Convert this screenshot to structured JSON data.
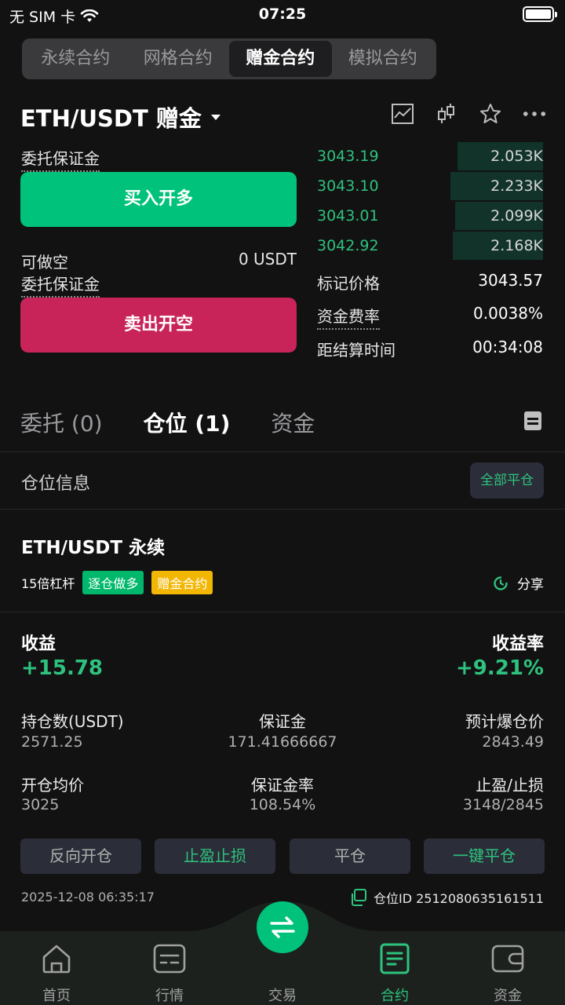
{
  "status": {
    "carrier": "无 SIM 卡",
    "time": "07:25"
  },
  "segments": [
    {
      "label": "永续合约",
      "active": false
    },
    {
      "label": "网格合约",
      "active": false
    },
    {
      "label": "赠金合约",
      "active": true
    },
    {
      "label": "模拟合约",
      "active": false
    }
  ],
  "header": {
    "pair": "ETH/USDT 赠金"
  },
  "trade": {
    "margin_label": "委托保证金",
    "buy_label": "买入开多",
    "short_avail_label": "可做空",
    "short_avail_value": "0 USDT",
    "margin_label2": "委托保证金",
    "sell_label": "卖出开空"
  },
  "orderbook": [
    {
      "price": "3043.19",
      "qty": "2.053K",
      "depth": 0.38
    },
    {
      "price": "3043.10",
      "qty": "2.233K",
      "depth": 0.41
    },
    {
      "price": "3043.01",
      "qty": "2.099K",
      "depth": 0.39
    },
    {
      "price": "3042.92",
      "qty": "2.168K",
      "depth": 0.4
    }
  ],
  "market": {
    "mark_label": "标记价格",
    "mark_value": "3043.57",
    "funding_label": "资金费率",
    "funding_value": "0.0038%",
    "settle_label": "距结算时间",
    "settle_value": "00:34:08"
  },
  "tabs": [
    {
      "label": "委托 (0)",
      "active": false
    },
    {
      "label": "仓位 (1)",
      "active": true
    },
    {
      "label": "资金",
      "active": false
    }
  ],
  "positions": {
    "header": "仓位信息",
    "close_all": "全部平仓",
    "title": "ETH/USDT 永续",
    "leverage": "15倍杠杆",
    "badge_mode": "逐仓做多",
    "badge_type": "赠金合约",
    "share": "分享",
    "pnl_label": "收益",
    "pnl_value": "+15.78",
    "roe_label": "收益率",
    "roe_value": "+9.21%",
    "size_label": "持仓数(USDT)",
    "size_value": "2571.25",
    "margin_label": "保证金",
    "margin_value": "171.41666667",
    "liq_label": "预计爆仓价",
    "liq_value": "2843.49",
    "entry_label": "开仓均价",
    "entry_value": "3025",
    "margin_rate_label": "保证金率",
    "margin_rate_value": "108.54%",
    "tpsl_label": "止盈/止损",
    "tpsl_value": "3148/2845",
    "btn_reverse": "反向开仓",
    "btn_tpsl": "止盈止损",
    "btn_close": "平仓",
    "btn_close_one": "一键平仓",
    "time": "2025-12-08 06:35:17",
    "pos_id": "仓位ID 2512080635161511"
  },
  "nav": [
    {
      "label": "首页",
      "icon": "home-icon"
    },
    {
      "label": "行情",
      "icon": "market-icon"
    },
    {
      "label": "交易",
      "icon": "swap-icon"
    },
    {
      "label": "合约",
      "icon": "contract-icon"
    },
    {
      "label": "资金",
      "icon": "wallet-icon"
    }
  ],
  "colors": {
    "green": "#00c27a",
    "red": "#c9245a",
    "bg": "#121212"
  }
}
